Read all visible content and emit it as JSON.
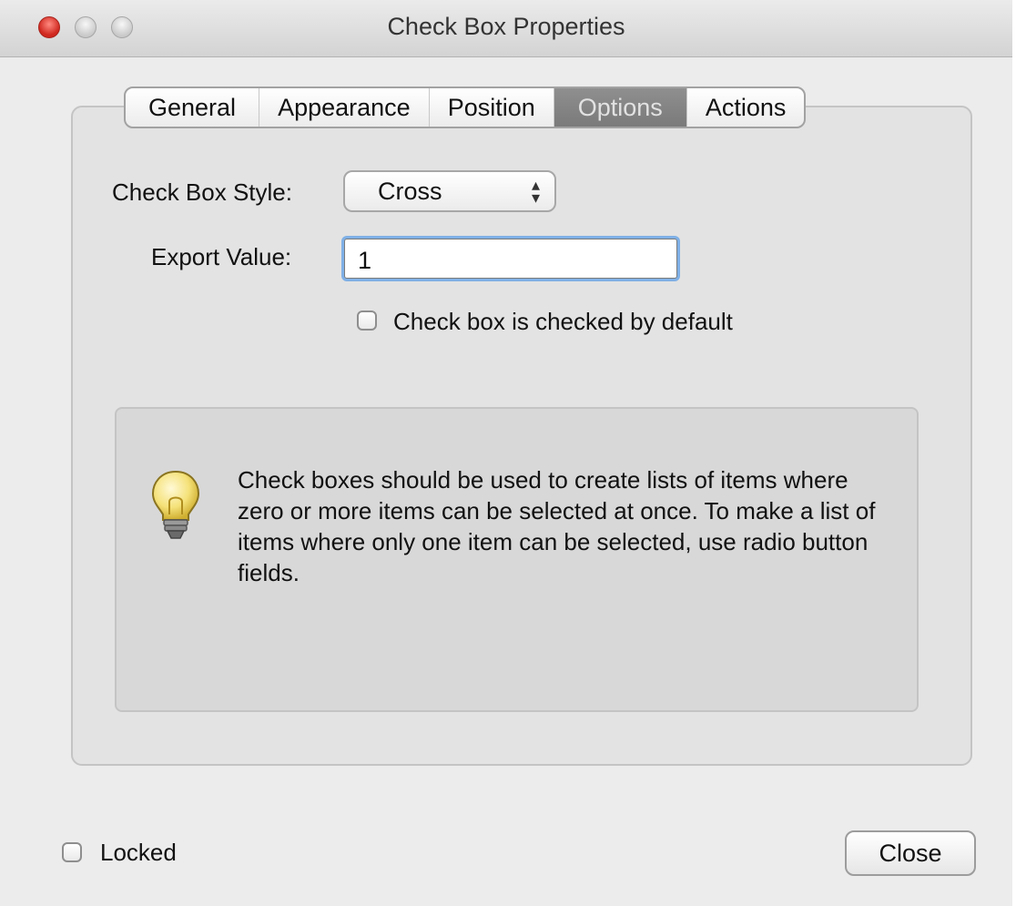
{
  "window": {
    "title": "Check Box Properties"
  },
  "tabs": [
    {
      "label": "General",
      "active": false
    },
    {
      "label": "Appearance",
      "active": false
    },
    {
      "label": "Position",
      "active": false
    },
    {
      "label": "Options",
      "active": true
    },
    {
      "label": "Actions",
      "active": false
    }
  ],
  "options": {
    "style_label": "Check Box Style:",
    "style_value": "Cross",
    "export_label": "Export Value:",
    "export_value": "1",
    "default_checked_label": "Check box is checked by default",
    "default_checked": false
  },
  "info": {
    "icon": "lightbulb-icon",
    "text": "Check boxes should be used to create lists of items where zero or more items can be selected at once. To make a list of items where only one item can be selected, use radio button fields."
  },
  "footer": {
    "locked_label": "Locked",
    "locked": false,
    "close_label": "Close"
  },
  "colors": {
    "active_tab": "#848484",
    "focus_ring": "#7fb0e6",
    "close_light": "#d0281f"
  }
}
